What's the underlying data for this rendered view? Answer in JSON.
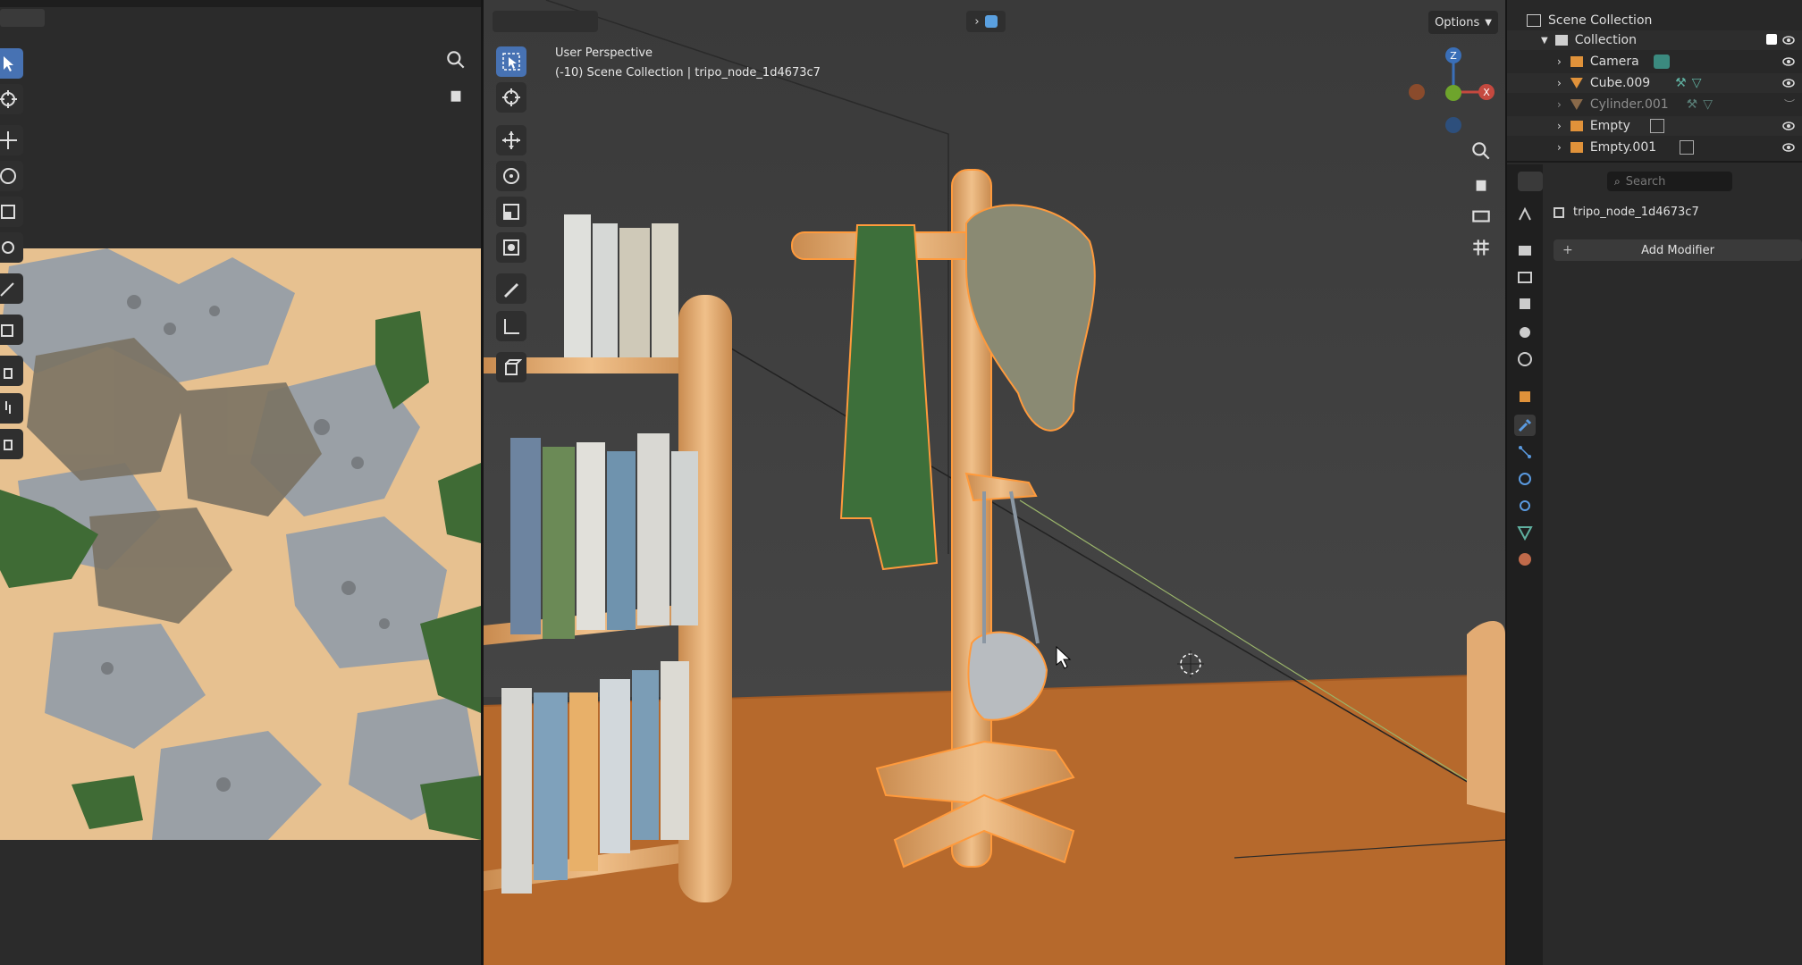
{
  "viewport": {
    "perspective_label": "User Perspective",
    "collection_label": "(-10) Scene Collection | tripo_node_1d4673c7",
    "options_label": "Options",
    "gizmo_axis_label": "Z",
    "gizmo_x_label": "X"
  },
  "outliner": {
    "items": [
      {
        "label": "Scene Collection"
      },
      {
        "label": "Collection"
      },
      {
        "label": "Camera"
      },
      {
        "label": "Cube.009"
      },
      {
        "label": "Cylinder.001"
      },
      {
        "label": "Empty"
      },
      {
        "label": "Empty.001"
      }
    ]
  },
  "properties": {
    "search_placeholder": "Search",
    "object_name": "tripo_node_1d4673c7",
    "add_modifier_label": "Add Modifier"
  },
  "colors": {
    "accent": "#4772b3",
    "selection_outline": "#ff9a3c",
    "wood": "#e0a868",
    "floor": "#b4692e"
  }
}
